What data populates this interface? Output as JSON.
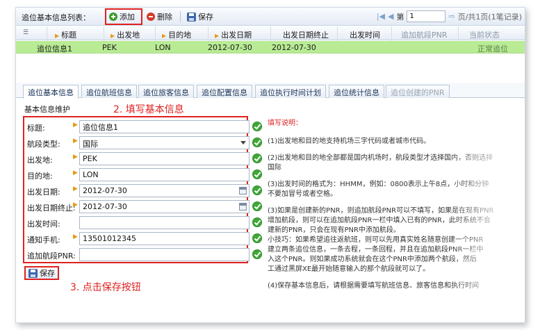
{
  "toolbar": {
    "list_title": "追位基本信息列表：",
    "add_label": "添加",
    "delete_label": "删除",
    "save_label": "保存",
    "page_prefix": "第",
    "page_value": "1",
    "page_total": "页/共1页(1笔记录)"
  },
  "grid": {
    "headers": [
      "标题",
      "出发地",
      "目的地",
      "出发日期",
      "出发日期终止",
      "出发时间",
      "追加航段PNR",
      "当前状态"
    ],
    "row": [
      "追位信息1",
      "PEK",
      "LON",
      "2012-07-30",
      "2012-07-30",
      "",
      "",
      "正常追位"
    ]
  },
  "tabs": [
    "追位基本信息",
    "追位航班信息",
    "追位旅客信息",
    "追位配置信息",
    "追位执行时间计划",
    "追位统计信息",
    "追位创建的PNR"
  ],
  "section": {
    "title": "基本信息维护",
    "annot_fill": "2. 填写基本信息",
    "annot_save": "3. 点击保存按钮"
  },
  "form": {
    "title_label": "标题:",
    "title_value": "追位信息1",
    "segment_label": "航段类型:",
    "segment_value": "国际",
    "origin_label": "出发地:",
    "origin_value": "PEK",
    "dest_label": "目的地:",
    "dest_value": "LON",
    "date_label": "出发日期:",
    "date_value": "2012-07-30",
    "date_end_label": "出发日期终止:",
    "date_end_value": "2012-07-30",
    "time_label": "出发时间:",
    "time_value": "",
    "phone_label": "通知手机:",
    "phone_value": "13501012345",
    "pnr_label": "追加航段PNR:",
    "pnr_value": "",
    "save_label": "保存"
  },
  "help": {
    "title": "填写说明：",
    "p1": "(1)出发地和目的地支持机场三字代码或者城市代码。",
    "p2a": "(2)出发地和目的地全部都是国内机场时，航段类型才选择国内，否则选择",
    "p2b": "国际",
    "p3a": "(3)出发时间的格式为：HHMM，例如：0800表示上午8点，小时和分钟",
    "p3b": "不要加冒号或者空格。",
    "p4a": "(3)如果是创建新的PNR，则追加航段PNR可以不填写，如果是在现有PNR",
    "p4b": "增加航段，则可以在追加航段PNR一栏中填入已有的PNR，此时系统不会",
    "p4c": "建新的PNR，只会在现有PNR中添加航段。",
    "p4d": "小技巧：如果希望追往返航班，则可以先用真实姓名随意创建一个PNR",
    "p4e": "建立两条追位信息，一条去程，一条回程，并且在追加航段PNR一栏中",
    "p4f": "入这个PNR。则如果成功系统就会在这个PNR中添加两个航段，然后",
    "p4g": "工通过黑屏XE最开始随意输入的那个航段就可以了。",
    "p5": "(4)保存基本信息后，请根据需要填写航班信息、旅客信息和执行时间"
  }
}
